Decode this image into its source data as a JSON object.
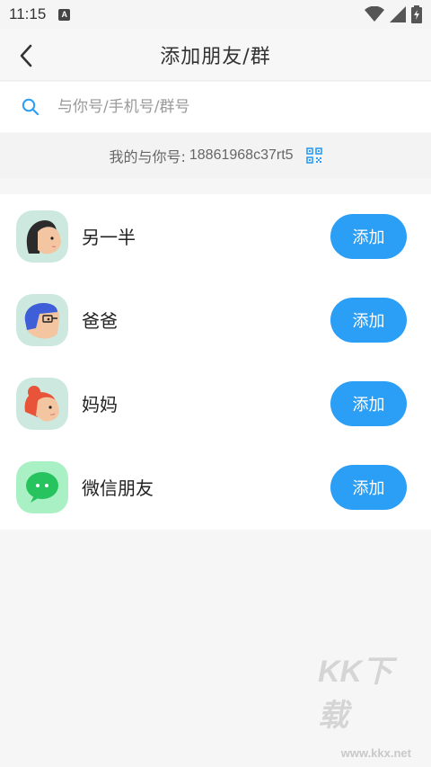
{
  "status_bar": {
    "time": "11:15",
    "notification_icon": "a-icon",
    "right_icons": [
      "wifi-icon",
      "signal-icon",
      "battery-charging-icon"
    ]
  },
  "header": {
    "title": "添加朋友/群",
    "back_icon": "chevron-left-icon"
  },
  "search": {
    "placeholder": "与你号/手机号/群号",
    "value": ""
  },
  "my_id": {
    "label": "我的与你号: ",
    "value": "18861968c37rt5",
    "icon": "qr-code-icon"
  },
  "contacts": [
    {
      "label": "另一半",
      "button": "添加",
      "avatar": "woman-avatar-icon"
    },
    {
      "label": "爸爸",
      "button": "添加",
      "avatar": "dad-avatar-icon"
    },
    {
      "label": "妈妈",
      "button": "添加",
      "avatar": "mom-avatar-icon"
    },
    {
      "label": "微信朋友",
      "button": "添加",
      "avatar": "wechat-avatar-icon"
    }
  ],
  "watermark": {
    "text": "KK下载",
    "url": "www.kkx.net"
  },
  "colors": {
    "accent": "#2b9ef5",
    "background": "#f6f6f6"
  }
}
